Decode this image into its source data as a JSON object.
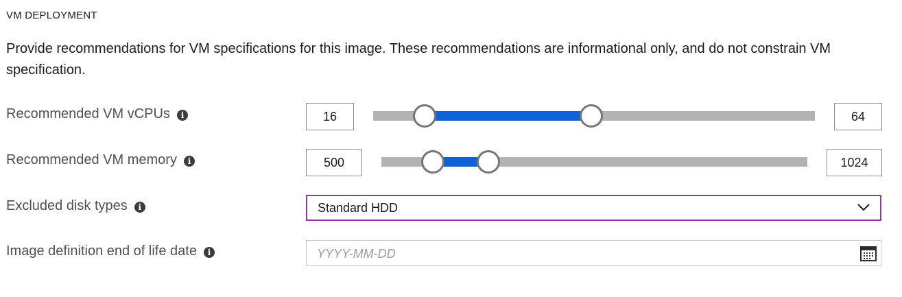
{
  "section": {
    "title": "VM DEPLOYMENT",
    "description": "Provide recommendations for VM specifications for this image. These recommendations are informational only, and do not constrain VM specification."
  },
  "vcpus": {
    "label": "Recommended VM vCPUs",
    "info_icon": "info-icon",
    "min_value": "16",
    "max_value": "64",
    "slider": {
      "low_fraction": 0.117,
      "high_fraction": 0.494,
      "fill_color": "#0f62d6",
      "track_color": "#b3b3b3"
    }
  },
  "memory": {
    "label": "Recommended VM memory",
    "info_icon": "info-icon",
    "min_value": "500",
    "max_value": "1024",
    "slider": {
      "low_fraction": 0.121,
      "high_fraction": 0.251,
      "fill_color": "#0f62d6",
      "track_color": "#b3b3b3"
    }
  },
  "disk_types": {
    "label": "Excluded disk types",
    "info_icon": "info-icon",
    "selected": "Standard HDD",
    "dropdown_icon": "chevron-down-icon",
    "border_color": "#8f3a9c"
  },
  "end_of_life": {
    "label": "Image definition end of life date",
    "info_icon": "info-icon",
    "value": "",
    "placeholder": "YYYY-MM-DD",
    "picker_icon": "calendar-icon"
  }
}
